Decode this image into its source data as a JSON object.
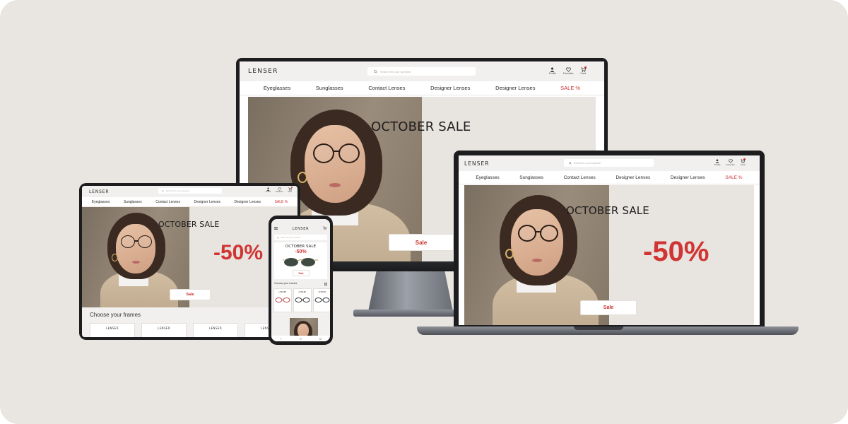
{
  "brand": {
    "logo": "LENSER"
  },
  "search": {
    "placeholder": "Search for your eyewear"
  },
  "header_icons": [
    {
      "label": "Profile",
      "icon": "user-icon"
    },
    {
      "label": "Favorites",
      "icon": "heart-icon"
    },
    {
      "label": "Card",
      "icon": "cart-icon"
    }
  ],
  "nav": {
    "items": [
      "Eyeglasses",
      "Sunglasses",
      "Contact Lenses",
      "Designer Lenses",
      "Designer Lenses"
    ],
    "sale": "SALE %"
  },
  "hero": {
    "title": "OCTOBER SALE",
    "discount": "-50%",
    "button": "Sale"
  },
  "frames_section": {
    "title": "Choose your frames",
    "mobile_title": "Choose your frames",
    "card_brand": "LENSER"
  },
  "colors": {
    "accent": "#c8312f",
    "background": "#e9e5e1",
    "header": "#f1f0ee",
    "hero": "#e8e4e0"
  }
}
